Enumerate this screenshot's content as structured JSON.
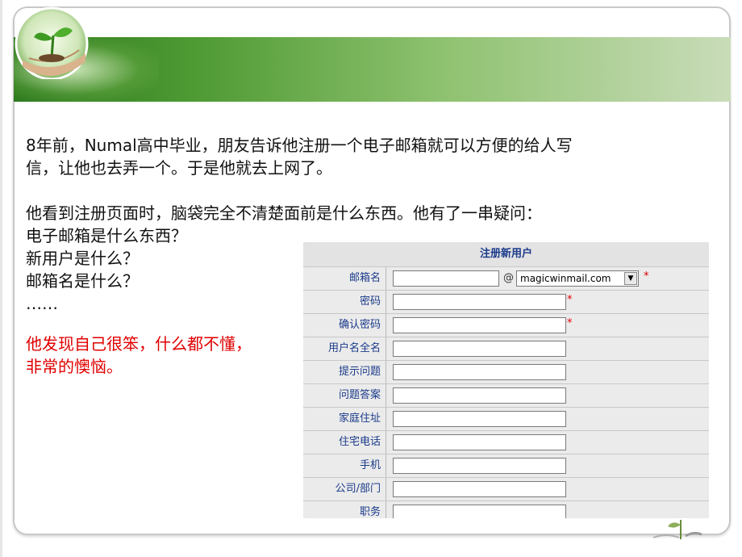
{
  "slide": {
    "paragraphs": [
      "8年前，Numal高中毕业，朋友告诉他注册一个电子邮箱就可以方便的给人写",
      "信，让他也去弄一个。于是他就去上网了。"
    ],
    "lines2": [
      "他看到注册页面时，脑袋完全不清楚面前是什么东西。他有了一串疑问：",
      "电子邮箱是什么东西？",
      "新用户是什么？",
      "邮箱名是什么？",
      "……"
    ],
    "red_lines": [
      "他发现自己很笨，什么都不懂，",
      "非常的懊恼。"
    ]
  },
  "form": {
    "title": "注册新用户",
    "at_symbol": "@",
    "domain_selected": "magicwinmail.com",
    "required_mark": "*",
    "fields": [
      {
        "label": "邮箱名"
      },
      {
        "label": "密码"
      },
      {
        "label": "确认密码"
      },
      {
        "label": "用户名全名"
      },
      {
        "label": "提示问题"
      },
      {
        "label": "问题答案"
      },
      {
        "label": "家庭住址"
      },
      {
        "label": "住宅电话"
      },
      {
        "label": "手机"
      },
      {
        "label": "公司/部门"
      },
      {
        "label": "职务"
      }
    ]
  },
  "colors": {
    "banner_green": "#4e9a33",
    "red_text": "#e00000",
    "form_label": "#1a3a8a"
  }
}
